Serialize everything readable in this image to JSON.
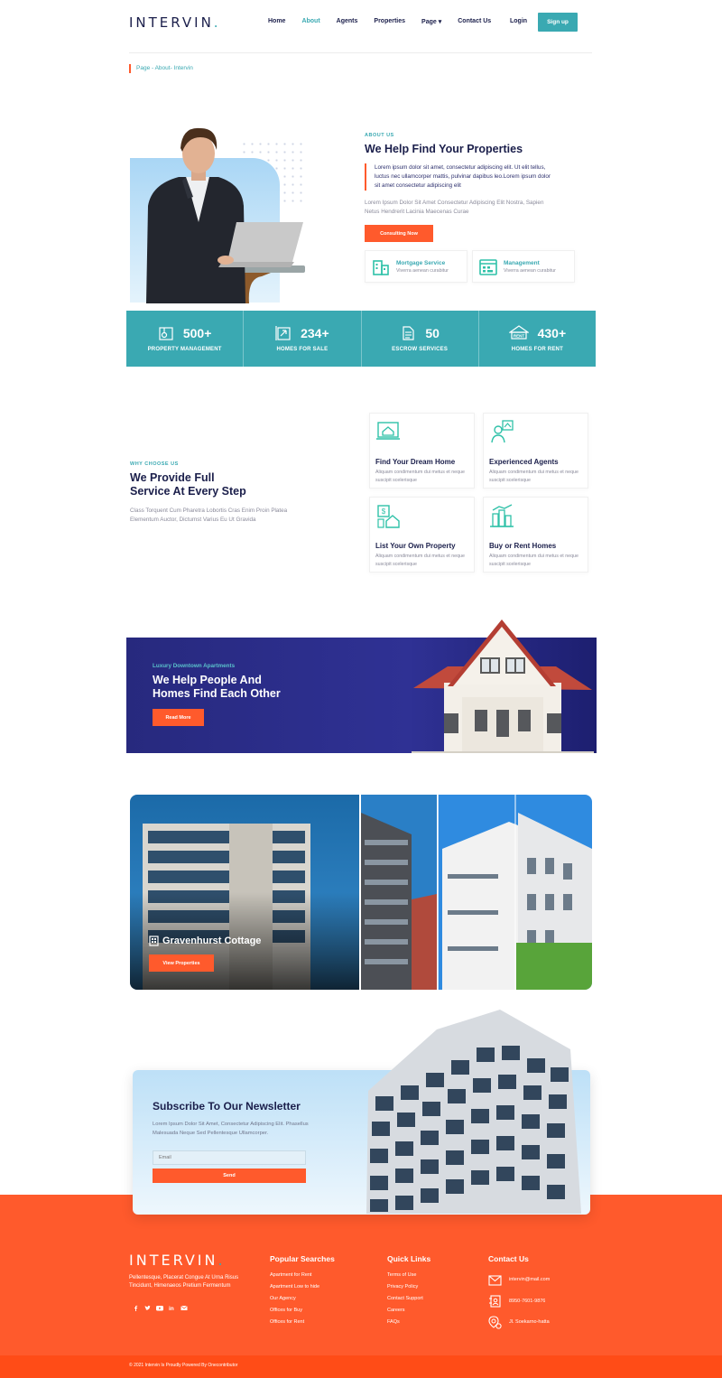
{
  "header": {
    "logo": "INTERVIN",
    "logo_dot": ".",
    "nav": [
      {
        "label": "Home",
        "active": false
      },
      {
        "label": "About",
        "active": true
      },
      {
        "label": "Agents",
        "active": false
      },
      {
        "label": "Properties",
        "active": false
      },
      {
        "label": "Page ▾",
        "active": false
      },
      {
        "label": "Contact Us",
        "active": false
      }
    ],
    "login": "Login",
    "signup": "Sign up"
  },
  "breadcrumb": "Page - About- Intervin",
  "about": {
    "label": "ABOUT US",
    "title": "We Help Find Your Properties",
    "quote": "Lorem ipsum dolor sit amet, consectetur adipiscing elit. Ut elit tellus, luctus nec ullamcorper mattis, pulvinar dapibus leo.Lorem ipsum dolor sit amet consectetur adipiscing elit",
    "text": "Lorem Ipsum Dolor Sit Amet Consectetur Adipiscing Elit Nostra, Sapien Netus Hendrerit Lacinia Maecenas Curae",
    "button": "Consulting Now",
    "cards": [
      {
        "title": "Mortgage Service",
        "sub": "Viverra aenean curabitur"
      },
      {
        "title": "Management",
        "sub": "Viverra aenean curabitur"
      }
    ]
  },
  "stats": [
    {
      "num": "500+",
      "cap": "PROPERTY MANAGEMENT"
    },
    {
      "num": "234+",
      "cap": "HOMES FOR SALE"
    },
    {
      "num": "50",
      "cap": "ESCROW SERVICES"
    },
    {
      "num": "430+",
      "cap": "HOMES FOR RENT"
    }
  ],
  "why": {
    "label": "WHY CHOOSE US",
    "title1": "We Provide Full",
    "title2": "Service At Every Step",
    "text": "Class Torquent Cum Pharetra Lobortis Cras Enim Proin Platea Elementum Auctor, Dictumst Varius Eu Ut Gravida",
    "cards": [
      {
        "title": "Find Your Dream Home",
        "sub": "Aliquam condimentum dui metus et neque suscipit scelerisque"
      },
      {
        "title": "Experienced Agents",
        "sub": "Aliquam condimentum dui metus et neque suscipit scelerisque"
      },
      {
        "title": "List Your Own Property",
        "sub": "Aliquam condimentum dui metus et neque suscipit scelerisque"
      },
      {
        "title": "Buy or Rent Homes",
        "sub": "Aliquam condimentum dui metus et neque suscipit scelerisque"
      }
    ]
  },
  "banner": {
    "label": "Luxury Downtown Apartments",
    "title1": "We Help People And",
    "title2": "Homes Find Each Other",
    "button": "Read More"
  },
  "gallery": {
    "title": "Gravenhurst Cottage",
    "button": "View Properties"
  },
  "newsletter": {
    "title": "Subscribe To Our Newsletter",
    "text": "Lorem Ipsum Dolor Sit Amet, Consectetur Adipiscing Elit. Phasellus Malesuada Neque Sed Pellentesque Ullamcorper.",
    "placeholder": "Email",
    "button": "Send"
  },
  "footer": {
    "logo": "INTERVIN",
    "logo_dot": ".",
    "about": "Pellentesque, Placerat Congue At Urna Risus Tincidunt, Himenaeos Pretium Fermentum",
    "popular_title": "Popular Searches",
    "popular": [
      "Apartment for Rent",
      "Apartment Low to hide",
      "Our Agency",
      "Offices for Buy",
      "Offices for Rent"
    ],
    "quick_title": "Quick Links",
    "quick": [
      "Terms of Use",
      "Privacy Policy",
      "Contact Support",
      "Careers",
      "FAQs"
    ],
    "contact_title": "Contact Us",
    "contact": [
      "intervin@mail.com",
      "8950-7601-9876",
      "Jl. Soekarno-hatta"
    ],
    "copyright": "© 2021 Intervin Is Proudly Powered By Onecontributor"
  },
  "colors": {
    "teal": "#3aa9b2",
    "orange": "#ff5a2c",
    "navy": "#1b1f4b",
    "banner": "#2f3194"
  }
}
